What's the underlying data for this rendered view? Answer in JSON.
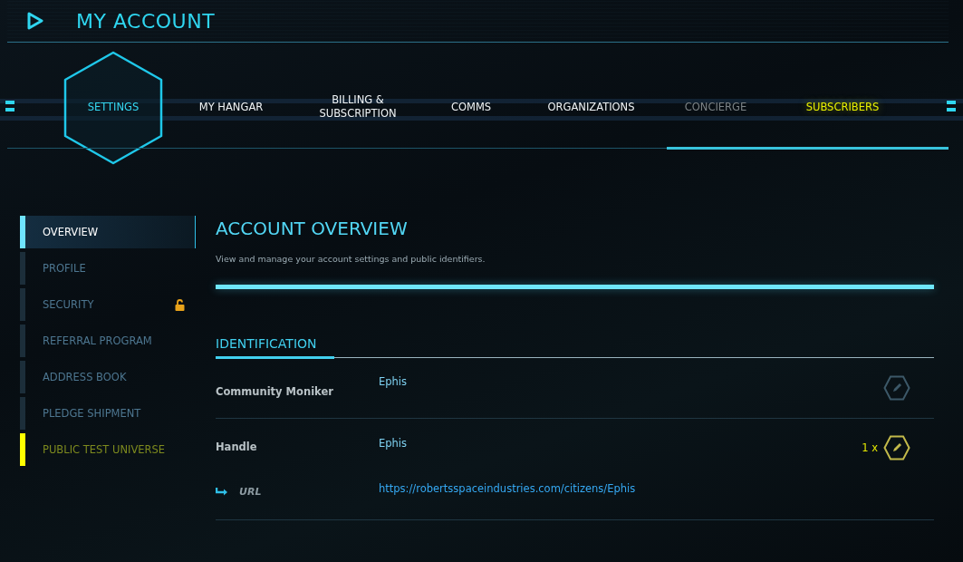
{
  "header": {
    "title": "MY ACCOUNT"
  },
  "nav": [
    {
      "label": "SETTINGS",
      "selected": true,
      "kind": "normal"
    },
    {
      "label": "MY HANGAR",
      "selected": false,
      "kind": "normal"
    },
    {
      "label": "BILLING & SUBSCRIPTION",
      "selected": false,
      "kind": "normal"
    },
    {
      "label": "COMMS",
      "selected": false,
      "kind": "normal"
    },
    {
      "label": "ORGANIZATIONS",
      "selected": false,
      "kind": "normal"
    },
    {
      "label": "CONCIERGE",
      "selected": false,
      "kind": "dim"
    },
    {
      "label": "SUBSCRIBERS",
      "selected": false,
      "kind": "gold"
    }
  ],
  "sidebar": {
    "items": [
      {
        "label": "OVERVIEW",
        "selected": true,
        "color": "#6fe4ff",
        "lock": false
      },
      {
        "label": "PROFILE",
        "selected": false,
        "color": "#1c2e3a",
        "lock": false
      },
      {
        "label": "SECURITY",
        "selected": false,
        "color": "#1c2e3a",
        "lock": true
      },
      {
        "label": "REFERRAL PROGRAM",
        "selected": false,
        "color": "#1c2e3a",
        "lock": false
      },
      {
        "label": "ADDRESS BOOK",
        "selected": false,
        "color": "#1c2e3a",
        "lock": false
      },
      {
        "label": "PLEDGE SHIPMENT",
        "selected": false,
        "color": "#1c2e3a",
        "lock": false
      },
      {
        "label": "PUBLIC TEST UNIVERSE",
        "selected": false,
        "color": "#ffff00",
        "lock": false
      }
    ]
  },
  "main": {
    "title": "ACCOUNT OVERVIEW",
    "description": "View and manage your account settings and public identifiers.",
    "section": "IDENTIFICATION",
    "rows": [
      {
        "kind": "field",
        "label": "Community Moniker",
        "value": "Ephis",
        "edit_enabled": false
      },
      {
        "kind": "field",
        "label": "Handle",
        "value": "Ephis",
        "edit_enabled": true,
        "count": "1 x"
      },
      {
        "kind": "link",
        "label": "URL",
        "value": "https://robertsspaceindustries.com/citizens/Ephis"
      }
    ]
  }
}
